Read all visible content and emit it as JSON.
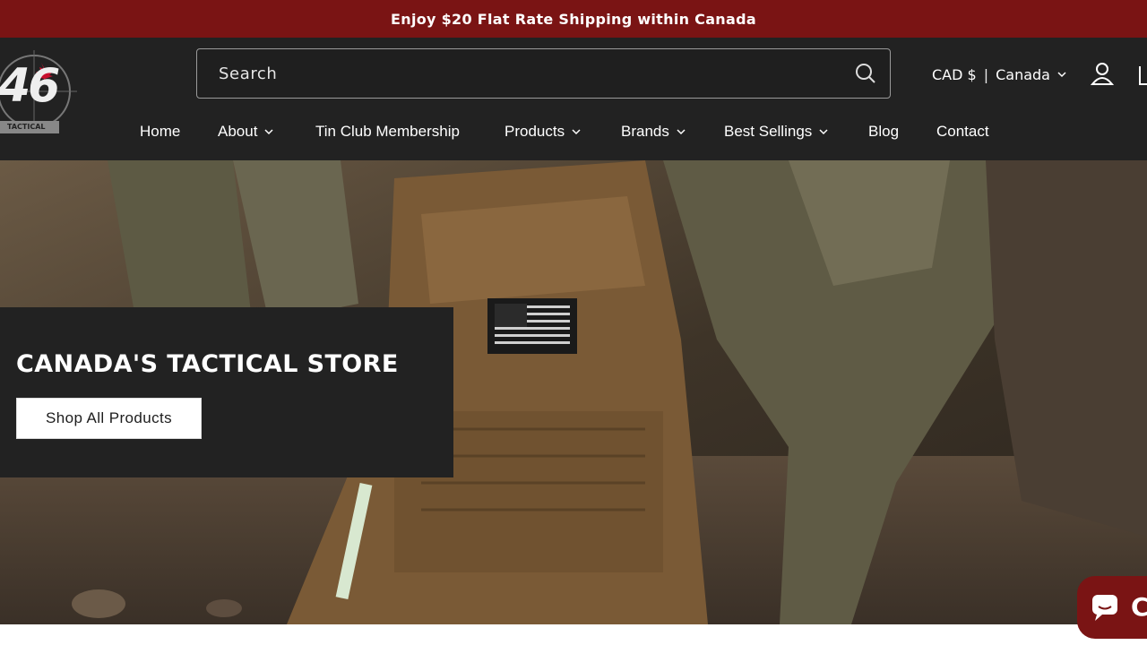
{
  "announcement": "Enjoy $20 Flat Rate Shipping within Canada",
  "logo": {
    "text": "46",
    "tagline": "TACTICAL"
  },
  "search": {
    "placeholder": "Search"
  },
  "localization": {
    "currency": "CAD $",
    "separator": "|",
    "country": "Canada"
  },
  "nav": {
    "home": "Home",
    "about": "About",
    "tin_club": "Tin Club Membership",
    "products": "Products",
    "brands": "Brands",
    "best_sellings": "Best Sellings",
    "blog": "Blog",
    "contact": "Contact"
  },
  "hero": {
    "title": "CANADA'S TACTICAL STORE",
    "button": "Shop All Products"
  },
  "chat": {
    "label": "C"
  },
  "colors": {
    "brand_red": "#7a1414",
    "header_bg": "#222222"
  },
  "icons": [
    "search-icon",
    "account-icon",
    "cart-icon",
    "chevron-down-icon",
    "chat-icon",
    "maple-leaf-icon"
  ]
}
